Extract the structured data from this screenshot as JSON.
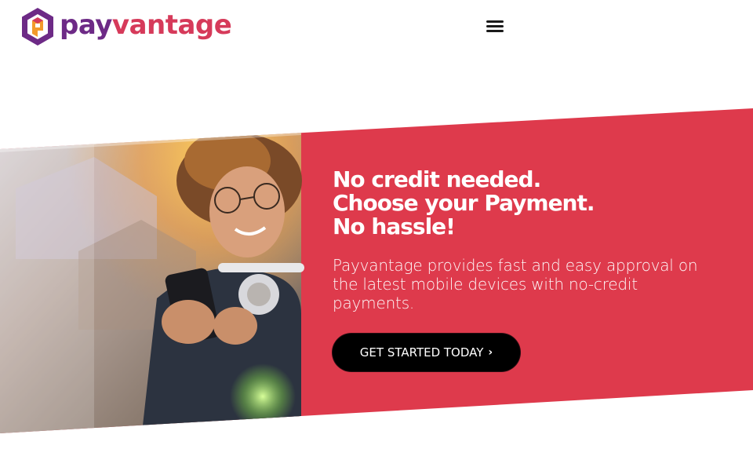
{
  "brand": {
    "name_part1": "pay",
    "name_part2": "vantage",
    "logo_icon": "payvantage-hexagon-logo",
    "colors": {
      "purple": "#6d2a86",
      "orange": "#f39a2b",
      "pink": "#d63a5a"
    }
  },
  "header": {
    "menu_icon": "hamburger-menu-icon"
  },
  "hero": {
    "background_color": "#de3a4c",
    "headline_lines": [
      "No credit needed.",
      "Choose your Payment.",
      "No hassle!"
    ],
    "description": "Payvantage provides fast and easy approval on the latest mobile devices with no-credit payments.",
    "cta_label": "GET STARTED TODAY",
    "cta_icon": "chevron-right-icon",
    "image_alt": "woman-using-smartphone-photo"
  }
}
